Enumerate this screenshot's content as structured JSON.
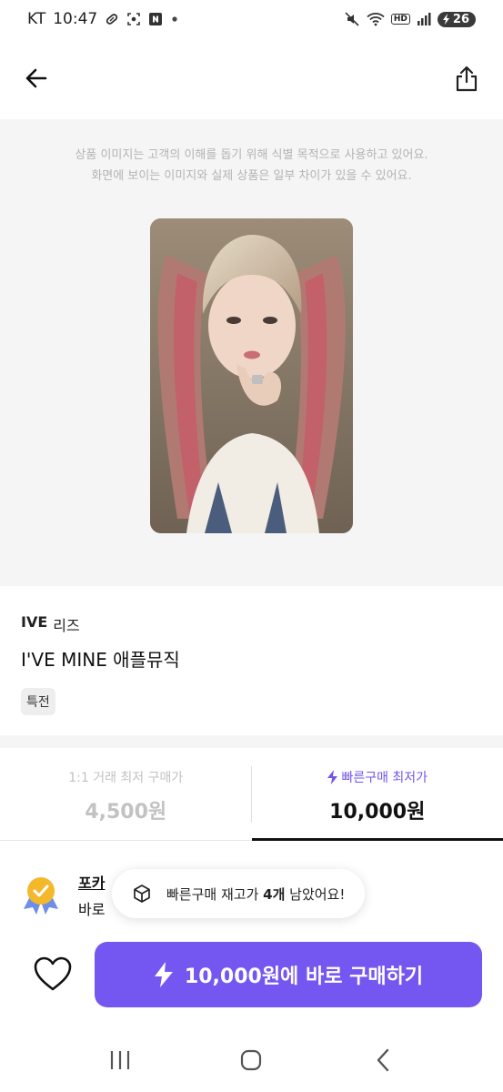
{
  "status_bar": {
    "carrier": "KT",
    "time": "10:47",
    "hd_label": "HD",
    "battery": "26"
  },
  "header": {
    "back_icon": "arrow-left-icon",
    "share_icon": "share-icon"
  },
  "image_area": {
    "notice_line1": "상품 이미지는 고객의 이해를 돕기 위해 식별 목적으로 사용하고 있어요.",
    "notice_line2": "화면에 보이는 이미지와 실제 상품은 일부 차이가 있을 수 있어요."
  },
  "product": {
    "brand": "IVE",
    "member": "리즈",
    "name": "I'VE MINE 애플뮤직",
    "tag": "특전"
  },
  "price_tabs": [
    {
      "label": "1:1 거래 최저 구매가",
      "price": "4,500원",
      "active": false
    },
    {
      "label": "빠른구매 최저가",
      "price": "10,000원",
      "active": true
    }
  ],
  "seller": {
    "title": "포카",
    "subtitle": "바로"
  },
  "toast": {
    "text_before": "빠른구매 재고가 ",
    "count": "4개",
    "text_after": " 남았어요!"
  },
  "buy_button": {
    "label": "10,000원에 바로 구매하기"
  },
  "colors": {
    "accent": "#7457f0",
    "accent_text": "#7355e8",
    "muted": "#c2c2c2",
    "image_bg": "#f5f5f5"
  }
}
